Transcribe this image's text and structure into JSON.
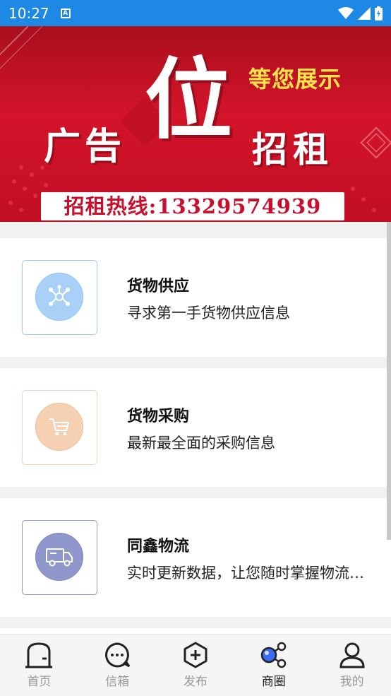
{
  "status_bar": {
    "time": "10:27",
    "notif_letter": "A"
  },
  "banner": {
    "big_char": "位",
    "left_text": "广告",
    "right_text": "招租",
    "top_text": "等您展示",
    "hotline": "招租热线:13329574939",
    "colors": {
      "background": "#c8102e",
      "accent": "#ffe54a"
    }
  },
  "cards": [
    {
      "title": "货物供应",
      "desc": "寻求第一手货物供应信息",
      "icon": "network-nodes-icon",
      "color": "#9ccaf4",
      "border": "#9ccaf4"
    },
    {
      "title": "货物采购",
      "desc": "最新最全面的采购信息",
      "icon": "shopping-cart-icon",
      "color": "#f6d0b3",
      "border": "#f1d2b8"
    },
    {
      "title": "同鑫物流",
      "desc": "实时更新数据，让您随时掌握物流动态",
      "icon": "delivery-truck-icon",
      "color": "#8f97cc",
      "border": "#8f97cc"
    }
  ],
  "tabs": [
    {
      "label": "首页",
      "icon": "home-icon",
      "active": false
    },
    {
      "label": "信箱",
      "icon": "chat-bubble-icon",
      "active": false
    },
    {
      "label": "发布",
      "icon": "add-hexagon-icon",
      "active": false
    },
    {
      "label": "商圈",
      "icon": "share-circle-icon",
      "active": true
    },
    {
      "label": "我的",
      "icon": "user-icon",
      "active": false
    }
  ]
}
